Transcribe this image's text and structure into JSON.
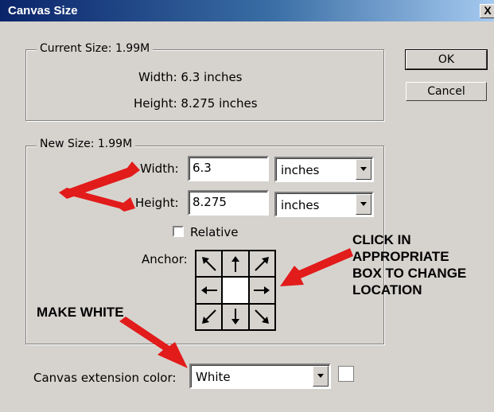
{
  "window": {
    "title": "Canvas Size",
    "close_glyph": "X"
  },
  "buttons": {
    "ok": "OK",
    "cancel": "Cancel"
  },
  "current_size": {
    "legend": "Current Size: 1.99M",
    "width_text": "Width:  6.3 inches",
    "height_text": "Height:  8.275 inches"
  },
  "new_size": {
    "legend": "New Size: 1.99M",
    "width_label": "Width:",
    "width_value": "6.3",
    "width_unit": "inches",
    "height_label": "Height:",
    "height_value": "8.275",
    "height_unit": "inches",
    "relative_label": "Relative",
    "relative_checked": false,
    "anchor_label": "Anchor:",
    "anchor_cells": [
      "arrow-nw",
      "arrow-n",
      "arrow-ne",
      "arrow-w",
      "center",
      "arrow-e",
      "arrow-sw",
      "arrow-s",
      "arrow-se"
    ]
  },
  "extension": {
    "label": "Canvas extension color:",
    "value": "White",
    "swatch_color": "#ffffff"
  },
  "annotations": {
    "click_note": [
      "CLICK IN",
      "APPROPRIATE",
      "BOX TO CHANGE",
      "LOCATION"
    ],
    "make_white": "MAKE WHITE",
    "arrow_color": "#e21b1b"
  }
}
